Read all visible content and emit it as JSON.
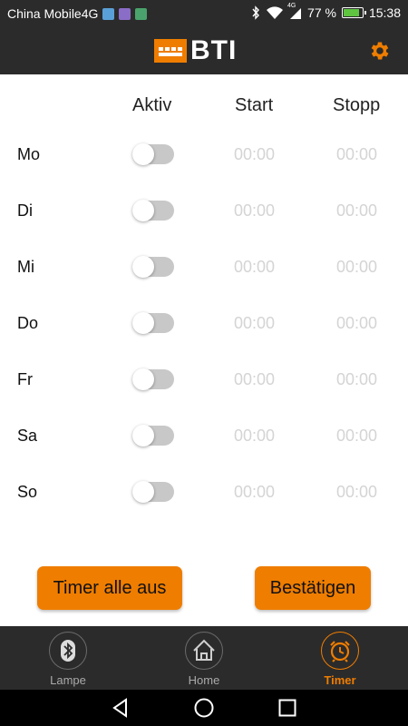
{
  "status_bar": {
    "carrier": "China Mobile4G",
    "network": "4G",
    "battery": "77 %",
    "time": "15:38"
  },
  "header": {
    "logo_text": "BTI",
    "settings_icon": "gear-icon"
  },
  "table": {
    "col_active": "Aktiv",
    "col_start": "Start",
    "col_stop": "Stopp",
    "rows": [
      {
        "day": "Mo",
        "active": false,
        "start": "00:00",
        "stop": "00:00"
      },
      {
        "day": "Di",
        "active": false,
        "start": "00:00",
        "stop": "00:00"
      },
      {
        "day": "Mi",
        "active": false,
        "start": "00:00",
        "stop": "00:00"
      },
      {
        "day": "Do",
        "active": false,
        "start": "00:00",
        "stop": "00:00"
      },
      {
        "day": "Fr",
        "active": false,
        "start": "00:00",
        "stop": "00:00"
      },
      {
        "day": "Sa",
        "active": false,
        "start": "00:00",
        "stop": "00:00"
      },
      {
        "day": "So",
        "active": false,
        "start": "00:00",
        "stop": "00:00"
      }
    ]
  },
  "buttons": {
    "all_off": "Timer alle aus",
    "confirm": "Bestätigen"
  },
  "bottom_nav": [
    {
      "label": "Lampe",
      "icon": "bluetooth-icon",
      "active": false
    },
    {
      "label": "Home",
      "icon": "home-icon",
      "active": false
    },
    {
      "label": "Timer",
      "icon": "alarm-clock-icon",
      "active": true
    }
  ],
  "colors": {
    "accent": "#ef7d00",
    "bar": "#2b2b2b",
    "toggle_off": "#c8c8c8",
    "time_text": "#d4d4d4"
  }
}
